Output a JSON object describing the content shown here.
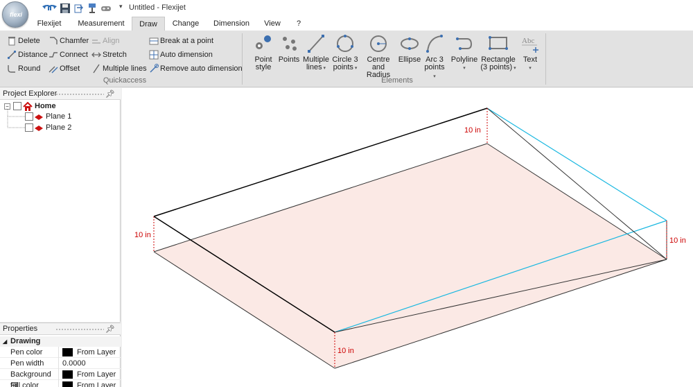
{
  "window": {
    "title": "Untitled - Flexijet",
    "orb_label": "flexi"
  },
  "tabs": [
    {
      "label": "Flexijet"
    },
    {
      "label": "Measurement"
    },
    {
      "label": "Draw"
    },
    {
      "label": "Change"
    },
    {
      "label": "Dimension"
    },
    {
      "label": "View"
    },
    {
      "label": "?"
    }
  ],
  "quickaccess": {
    "label": "Quickaccess",
    "delete": "Delete",
    "chamfer": "Chamfer",
    "align": "Align",
    "break_at_point": "Break at a point",
    "distance": "Distance",
    "connect": "Connect",
    "stretch": "Stretch",
    "auto_dimension": "Auto dimension",
    "round": "Round",
    "offset": "Offset",
    "multiple_lines": "Multiple lines",
    "remove_auto_dimension": "Remove auto dimension"
  },
  "elements": {
    "label": "Elements",
    "point_style": [
      "Point",
      "style"
    ],
    "points": [
      "Points",
      ""
    ],
    "multiple_lines": [
      "Multiple",
      "lines"
    ],
    "circle3": [
      "Circle 3",
      "points"
    ],
    "centre_radius": [
      "Centre and",
      "Radius"
    ],
    "ellipse": [
      "Ellipse",
      ""
    ],
    "arc3": [
      "Arc 3",
      "points"
    ],
    "polyline": [
      "Polyline",
      ""
    ],
    "rectangle": [
      "Rectangle",
      "(3 points)"
    ],
    "text": [
      "Text",
      ""
    ]
  },
  "project_explorer": {
    "title": "Project Explorer",
    "root": "Home",
    "items": [
      "Plane 1",
      "Plane 2"
    ]
  },
  "properties": {
    "title": "Properties",
    "category": "Drawing",
    "rows": [
      {
        "name": "Pen color",
        "value": "From Layer",
        "swatch": true
      },
      {
        "name": "Pen width",
        "value": "0.0000",
        "swatch": false
      },
      {
        "name": "Background fill",
        "value": "From Layer",
        "swatch": true
      },
      {
        "name": "Fill color",
        "value": "From Layer",
        "swatch": true
      }
    ]
  },
  "drawing": {
    "dimension_label": "10 in",
    "colors": {
      "fill": "#fbe9e5",
      "edge": "#000000",
      "highlight": "#17b7e0",
      "dimension": "#cc0000"
    }
  }
}
